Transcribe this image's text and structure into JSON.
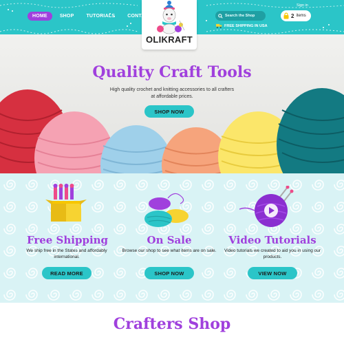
{
  "nav": {
    "items": [
      {
        "label": "HOME",
        "active": true
      },
      {
        "label": "SHOP",
        "active": false
      },
      {
        "label": "TUTORIALS",
        "active": false
      },
      {
        "label": "CONTACT",
        "active": false
      }
    ]
  },
  "logo": {
    "text": "OLIKRAFT",
    "icon": "llama-logo"
  },
  "search": {
    "placeholder": "Search the Shop",
    "icon": "search-icon"
  },
  "shipping_banner": {
    "text": "FREE SHIPPING IN USA",
    "icon": "truck-icon"
  },
  "account": {
    "signin_label": "Sign in"
  },
  "cart": {
    "count": "2",
    "label": "items",
    "icon": "lock-icon"
  },
  "hero": {
    "title": "Quality Craft Tools",
    "subtitle": "High quality crochet and knitting accessories to all crafters at affordable prices.",
    "button": "SHOP NOW"
  },
  "features": [
    {
      "title": "Free Shipping",
      "description": "We ship free in the States and affordably international.",
      "button": "READ MORE",
      "icon": "shipping-box-icon"
    },
    {
      "title": "On Sale",
      "description": "Browse our shop to see what items are on sale.",
      "button": "SHOP NOW",
      "icon": "yarn-sale-icon"
    },
    {
      "title": "Video Tutorials",
      "description": "Video tutorials we created to aid you in using our products.",
      "button": "VIEW NOW",
      "icon": "video-yarn-icon"
    }
  ],
  "shop_section": {
    "title": "Crafters Shop"
  },
  "colors": {
    "primary": "#a040dd",
    "accent": "#2bc5c8",
    "background": "#d9f3f5"
  }
}
